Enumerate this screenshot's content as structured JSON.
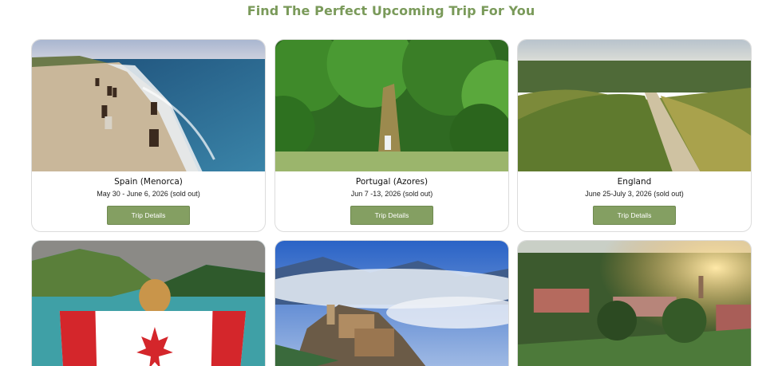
{
  "page": {
    "title": "Find The Perfect Upcoming Trip For You"
  },
  "trips": [
    {
      "name": "Spain (Menorca)",
      "dates": "May 30 - June 6, 2026 (sold out)",
      "button": "Trip Details",
      "image": "beach-horses-photo"
    },
    {
      "name": "Portugal (Azores)",
      "dates": "Jun 7 -13, 2026 (sold out)",
      "button": "Trip Details",
      "image": "forest-tree-photo"
    },
    {
      "name": "England",
      "dates": "June 25-July 3, 2026 (sold out)",
      "button": "Trip Details",
      "image": "countryside-path-photo"
    },
    {
      "image": "canada-flag-lake-photo"
    },
    {
      "image": "misty-hilltown-photo"
    },
    {
      "image": "campus-sunset-photo"
    }
  ],
  "colors": {
    "accent": "#849f62",
    "title": "#7a9a5a"
  }
}
